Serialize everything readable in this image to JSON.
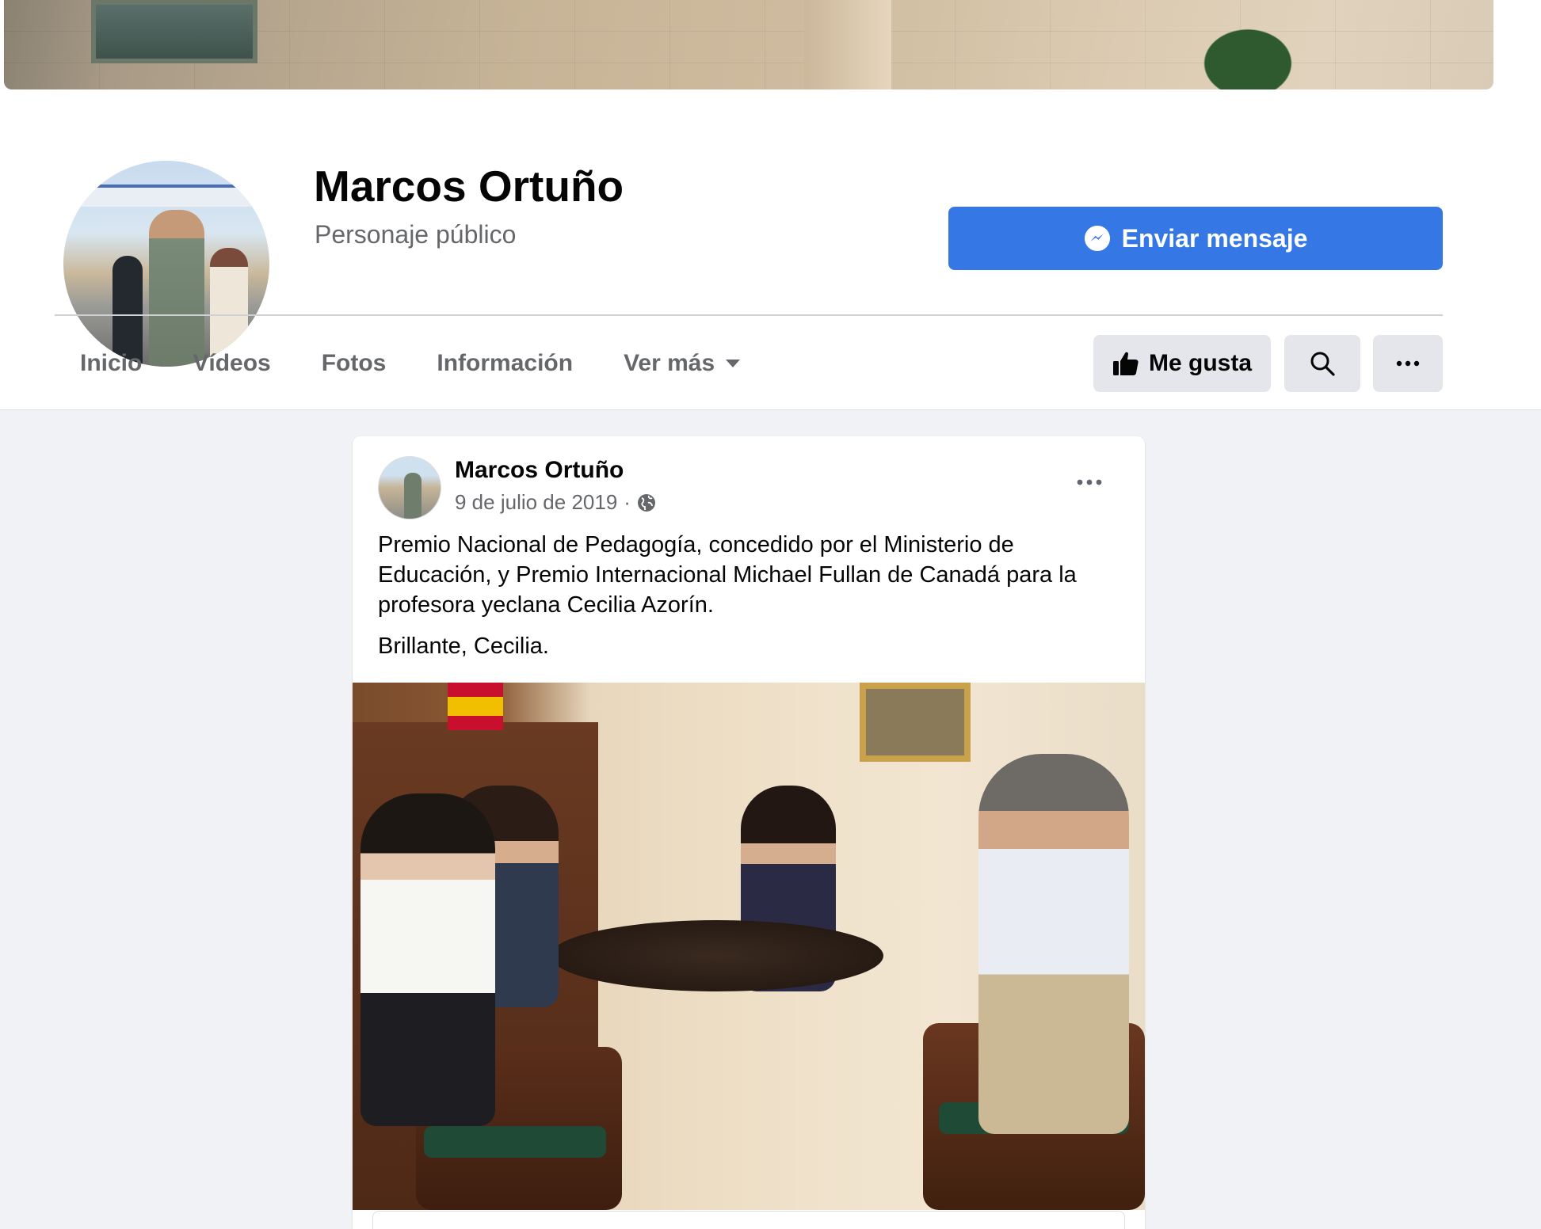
{
  "page": {
    "name": "Marcos Ortuño",
    "category": "Personaje público",
    "send_message_label": "Enviar mensaje"
  },
  "nav": {
    "items": [
      {
        "label": "Inicio"
      },
      {
        "label": "Vídeos"
      },
      {
        "label": "Fotos"
      },
      {
        "label": "Información"
      },
      {
        "label": "Ver más"
      }
    ],
    "like_label": "Me gusta"
  },
  "post": {
    "author": "Marcos Ortuño",
    "date": "9 de julio de 2019",
    "separator": "·",
    "text_paragraph_1": "Premio Nacional de Pedagogía, concedido por el Ministerio de Educación, y Premio Internacional Michael Fullan de Canadá para la profesora yeclana Cecilia Azorín.",
    "text_paragraph_2": "Brillante, Cecilia."
  },
  "icons": {
    "messenger": "messenger-icon",
    "like": "thumbs-up-icon",
    "search": "search-icon",
    "more": "more-horizontal-icon",
    "privacy": "globe-icon",
    "caret": "caret-down-icon"
  },
  "colors": {
    "primary_button": "#3578e5",
    "secondary_button": "#e4e6eb",
    "background": "#f0f2f5",
    "secondary_text": "#65676b"
  }
}
